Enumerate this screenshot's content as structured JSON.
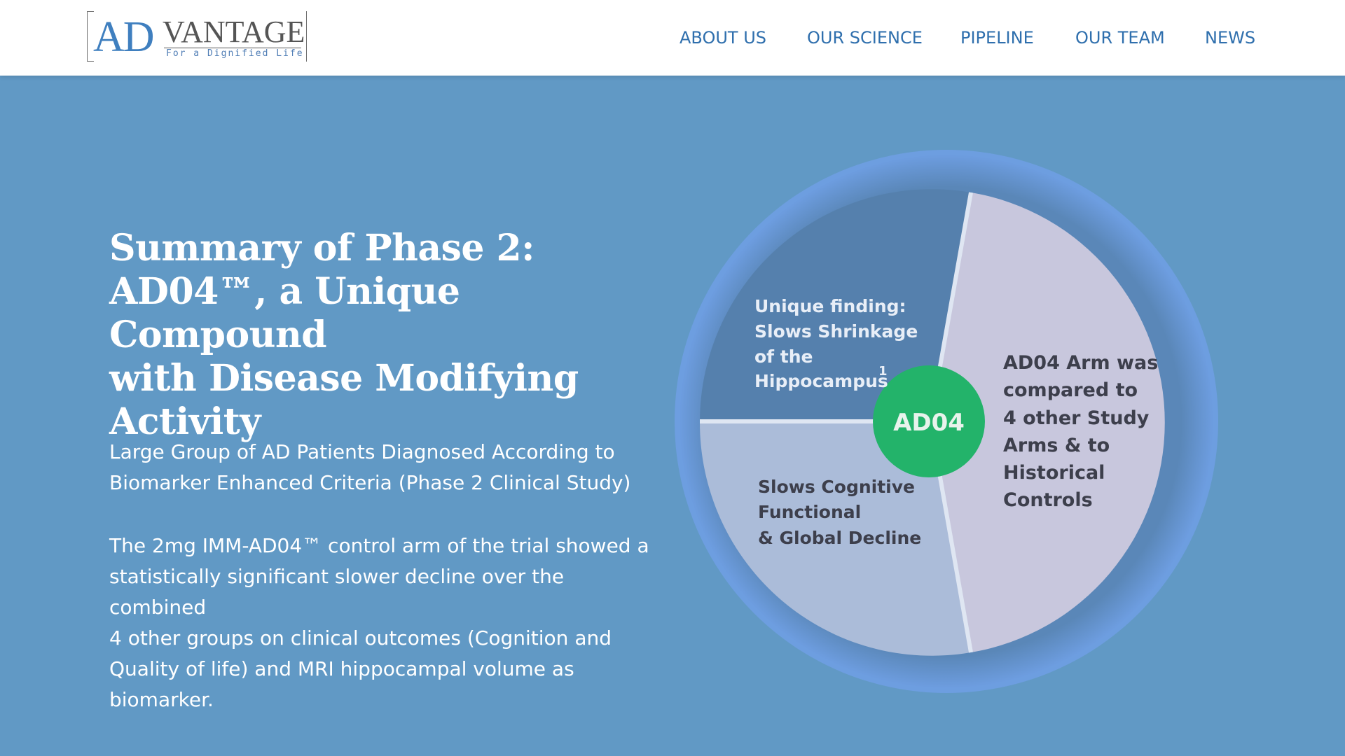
{
  "header": {
    "logo": {
      "primary": "AD",
      "secondary": "VANTAGE",
      "tagline": "For a Dignified Life"
    },
    "nav": [
      {
        "label": "ABOUT US"
      },
      {
        "label": "OUR SCIENCE"
      },
      {
        "label": "PIPELINE"
      },
      {
        "label": "OUR TEAM"
      },
      {
        "label": "NEWS"
      }
    ]
  },
  "main": {
    "headline_lines": [
      "Summary of Phase 2:",
      "AD04™, a Unique Compound",
      "with Disease Modifying",
      "Activity"
    ],
    "subtitle_lines": [
      "Large Group of AD Patients Diagnosed According to",
      "Biomarker Enhanced Criteria (Phase 2 Clinical Study)"
    ],
    "body_lines": [
      "The 2mg IMM-AD04™ control arm of the trial showed a",
      "statistically significant slower decline over the combined",
      "4 other groups on clinical outcomes (Cognition and",
      "Quality of life) and MRI hippocampal volume as",
      "biomarker."
    ]
  },
  "diagram": {
    "center_label": "AD04",
    "segments": [
      {
        "lines": [
          "Unique finding:",
          "Slows Shrinkage",
          "of the",
          "Hippocampus"
        ],
        "superscript": "1"
      },
      {
        "lines": [
          "Slows Cognitive",
          "Functional",
          "& Global Decline"
        ]
      },
      {
        "lines": [
          "AD04 Arm was",
          "compared to",
          "4 other Study",
          "Arms & to",
          "Historical",
          "Controls"
        ]
      }
    ],
    "colors": {
      "page_bg": "#6199c5",
      "ring": "#5e8fc9",
      "segment_top_left": "#5580ad",
      "segment_bottom_left": "#abbcd9",
      "segment_right": "#c7c6dc",
      "center": "#23b36a",
      "nav_text": "#2f6fad"
    }
  }
}
